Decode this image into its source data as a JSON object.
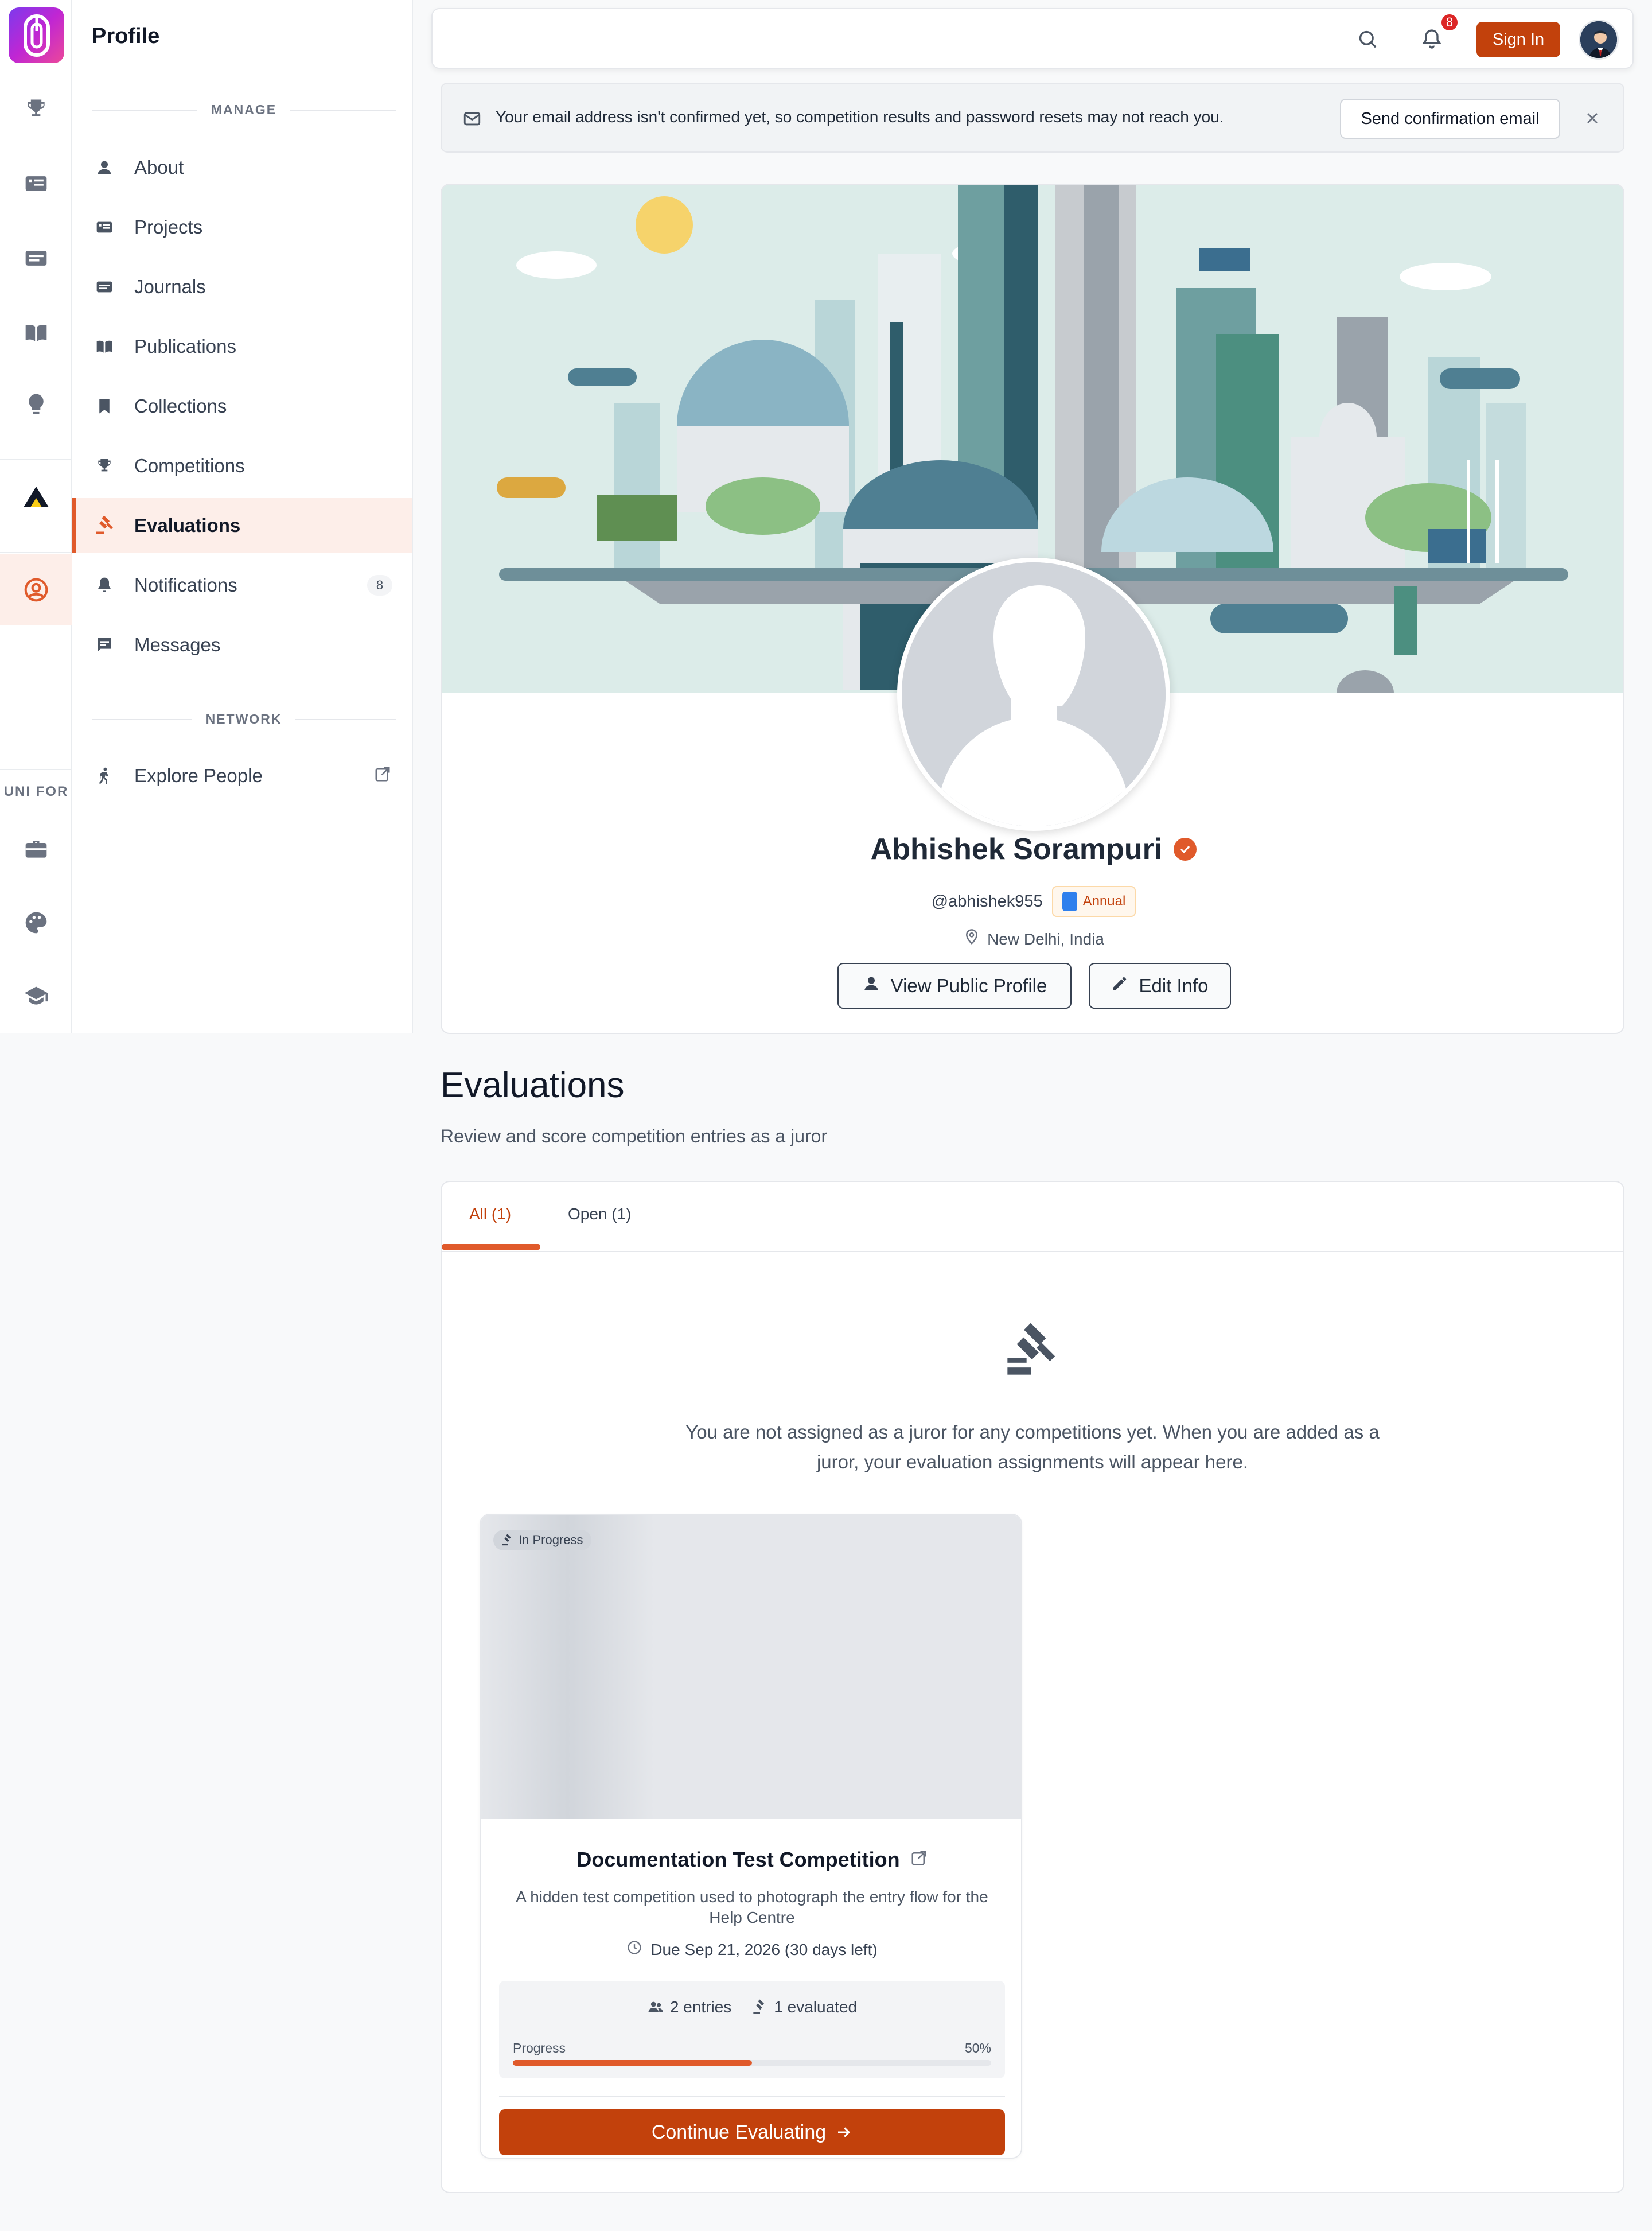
{
  "nav": {
    "title": "Profile",
    "sections": {
      "manage": "MANAGE",
      "network": "NETWORK"
    },
    "items": [
      {
        "label": "About"
      },
      {
        "label": "Projects"
      },
      {
        "label": "Journals"
      },
      {
        "label": "Publications"
      },
      {
        "label": "Collections"
      },
      {
        "label": "Competitions"
      },
      {
        "label": "Evaluations",
        "active": true
      },
      {
        "label": "Notifications",
        "badge": "8"
      },
      {
        "label": "Messages"
      }
    ],
    "network_items": [
      {
        "label": "Explore People"
      }
    ]
  },
  "rail": {
    "section_label": "UNI FOR"
  },
  "topbar": {
    "notification_count": "8",
    "signin_label": "Sign In"
  },
  "alert": {
    "message": "Your email address isn't confirmed yet, so competition results and password resets may not reach you.",
    "button_label": "Send confirmation email"
  },
  "profile": {
    "name": "Abhishek Sorampuri",
    "handle": "@abhishek955",
    "plan": "Annual",
    "location": "New Delhi, India",
    "view_public_label": "View Public Profile",
    "edit_label": "Edit Info"
  },
  "evaluations": {
    "title": "Evaluations",
    "subtitle": "Review and score competition entries as a juror",
    "tabs": [
      {
        "label": "All (1)",
        "active": true
      },
      {
        "label": "Open (1)"
      }
    ],
    "empty_message": "You are not assigned as a juror for any competitions yet. When you are added as a juror, your evaluation assignments will appear here.",
    "card": {
      "status": "In Progress",
      "title": "Documentation Test Competition",
      "description": "A hidden test competition used to photograph the entry flow for the Help Centre",
      "due": "Due Sep 21, 2026 (30 days left)",
      "entries": "2 entries",
      "evaluated": "1 evaluated",
      "progress_label": "Progress",
      "progress_text": "50%",
      "progress": 0.5,
      "button_label": "Continue Evaluating"
    }
  },
  "colors": {
    "accent": "#e05a2b",
    "primary_button": "#c2410c",
    "active_bg": "#fdeee9"
  }
}
